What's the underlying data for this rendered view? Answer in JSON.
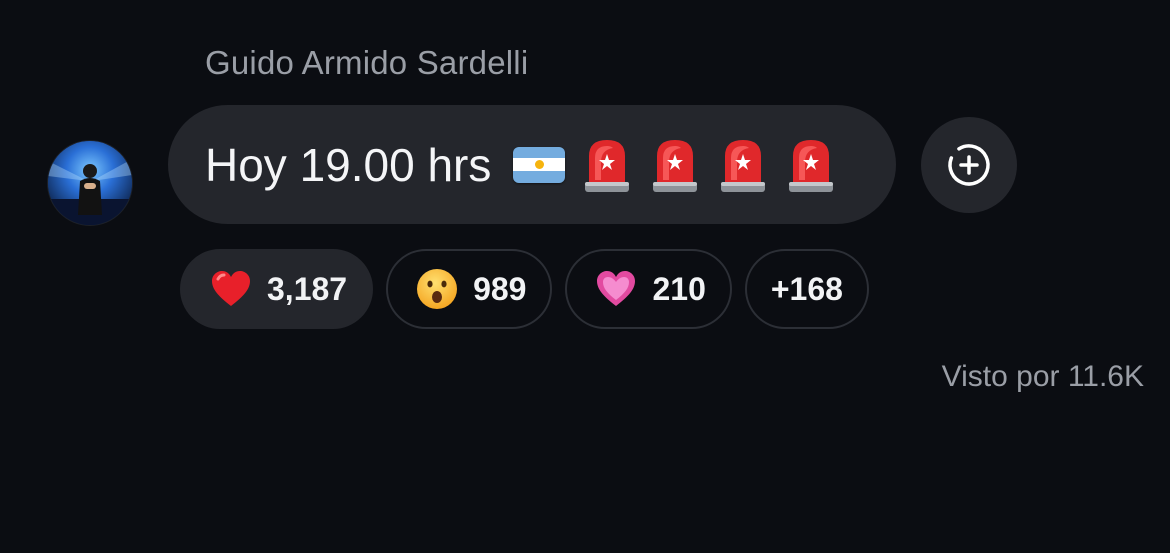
{
  "message": {
    "sender_name": "Guido Armido Sardelli",
    "text": "Hoy 19.00 hrs",
    "emojis": [
      "flag-argentina-icon",
      "police-siren-icon",
      "police-siren-icon",
      "police-siren-icon",
      "police-siren-icon"
    ]
  },
  "reactions": [
    {
      "emoji": "red-heart-icon",
      "count": "3,187"
    },
    {
      "emoji": "surprised-face-icon",
      "count": "989"
    },
    {
      "emoji": "pink-heart-icon",
      "count": "210"
    },
    {
      "emoji": null,
      "count": "+168"
    }
  ],
  "footer": {
    "seen_by": "Visto por 11.6K"
  },
  "colors": {
    "background": "#0b0d12",
    "bubble": "#24262c",
    "muted_text": "#9a9ea6"
  }
}
